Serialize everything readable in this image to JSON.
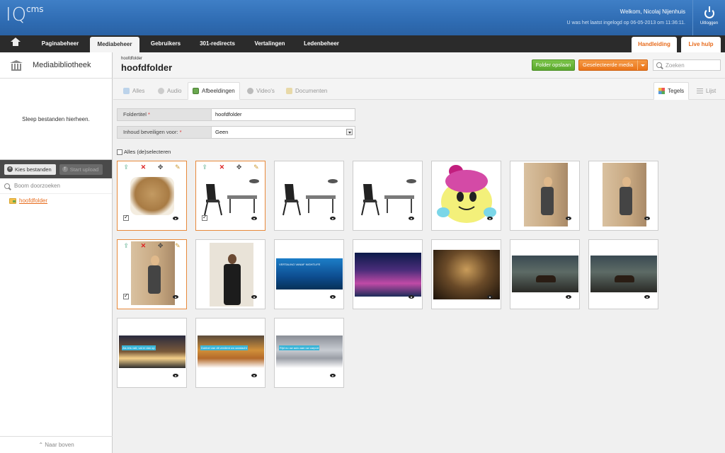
{
  "header": {
    "logo_main": "IQ",
    "logo_sup": "cms",
    "welcome": "Welkom, Nicolaj Nijenhuis",
    "last_login": "U was het laatst ingelogd op 06-05-2013 om 11:36:11.",
    "logout_label": "Uitloggen"
  },
  "nav": {
    "tabs": [
      "Paginabeheer",
      "Mediabeheer",
      "Gebruikers",
      "301-redirects",
      "Vertalingen",
      "Ledenbeheer"
    ],
    "active": "Mediabeheer",
    "right_tabs": [
      "Handleiding",
      "Live hulp"
    ]
  },
  "sidebar": {
    "title": "Mediabibliotheek",
    "dropzone": "Sleep bestanden hierheen.",
    "choose_files": "Kies bestanden",
    "start_upload": "Start upload",
    "tree_search_placeholder": "Boom doorzoeken",
    "tree_item": "hoofdfolder",
    "footer": "Naar boven"
  },
  "main": {
    "breadcrumb": "hoofdfolder",
    "title": "hoofdfolder",
    "save_folder": "Folder opslaan",
    "selected_media": "Geselecteerde media",
    "search_placeholder": "Zoeken"
  },
  "filter_tabs": {
    "items": [
      "Alles",
      "Audio",
      "Afbeeldingen",
      "Video's",
      "Documenten"
    ],
    "active": "Afbeeldingen",
    "view_tiles": "Tegels",
    "view_list": "Lijst"
  },
  "form": {
    "folder_title_label": "Foldertitel",
    "folder_title_value": "hoofdfolder",
    "protect_label": "Inhoud beveiligen voor:",
    "protect_value": "Geen",
    "required_marker": "*",
    "select_all": "Alles (de)selecteren"
  },
  "tiles": [
    {
      "kind": "bag",
      "checked": true,
      "selected": true
    },
    {
      "kind": "chairs",
      "checked": true,
      "selected": true
    },
    {
      "kind": "chairs",
      "checked": false,
      "selected": false
    },
    {
      "kind": "chairs",
      "checked": false,
      "selected": false
    },
    {
      "kind": "mascot",
      "checked": false,
      "selected": false
    },
    {
      "kind": "woman",
      "checked": false,
      "selected": false
    },
    {
      "kind": "woman",
      "checked": false,
      "selected": false
    },
    {
      "kind": "woman",
      "checked": true,
      "selected": true
    },
    {
      "kind": "woman-dark",
      "checked": false,
      "selected": false
    },
    {
      "kind": "banner-blue",
      "checked": false,
      "selected": false
    },
    {
      "kind": "city-night",
      "checked": false,
      "selected": false
    },
    {
      "kind": "car-interior",
      "checked": false,
      "selected": false
    },
    {
      "kind": "car-night",
      "checked": false,
      "selected": false
    },
    {
      "kind": "car-night",
      "checked": false,
      "selected": false
    },
    {
      "kind": "banner-paris",
      "checked": false,
      "selected": false
    },
    {
      "kind": "banner-street",
      "checked": false,
      "selected": false
    },
    {
      "kind": "banner-car",
      "checked": false,
      "selected": false
    }
  ],
  "banner_texts": {
    "blue": "VERTALING VANAF NIGHTLIFE",
    "paris": "Als iets valt, val er dan op",
    "street": "Dubbel van dit verdient uw aandacht",
    "car": "Rijd nu uw auto aan uw carport"
  },
  "colors": {
    "accent": "#e76b1c",
    "header_blue": "#2f6cb3",
    "nav_dark": "#2b2b2b",
    "green": "#5aa82d"
  }
}
